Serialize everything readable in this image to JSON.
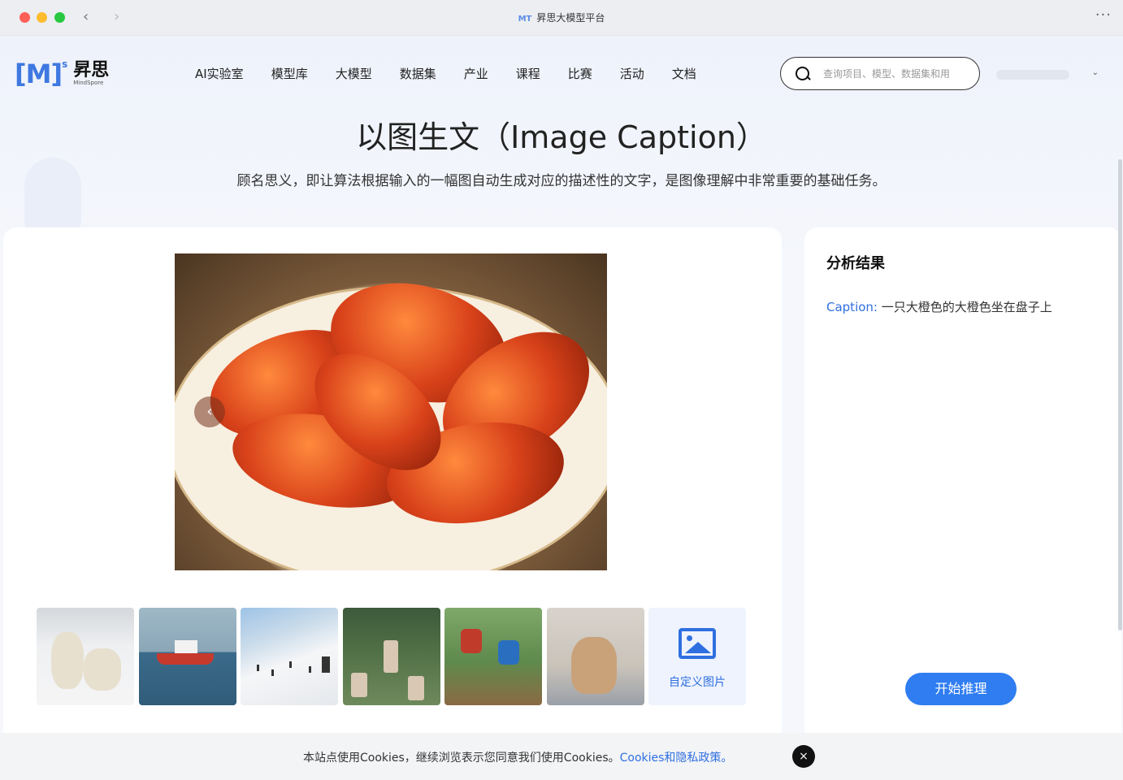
{
  "window": {
    "title": "昇思大模型平台",
    "title_logo": "MT",
    "back_glyph": "‹",
    "forward_glyph": "›",
    "more_glyph": "···"
  },
  "header": {
    "logo_mark": "[M]",
    "logo_sup": "s",
    "logo_cn": "昇思",
    "logo_en": "MindSpore",
    "nav": [
      "AI实验室",
      "模型库",
      "大模型",
      "数据集",
      "产业",
      "课程",
      "比赛",
      "活动",
      "文档"
    ],
    "search_placeholder": "查询项目、模型、数据集和用",
    "user_chevron": "⌄"
  },
  "hero": {
    "title": "以图生文（Image Caption）",
    "description": "顾名思义，即让算法根据输入的一幅图自动生成对应的描述性的文字，是图像理解中非常重要的基础任务。"
  },
  "viewer": {
    "prev_glyph": "‹",
    "thumbnails": [
      "polar-bears",
      "ship",
      "ski-slope",
      "frisbee-game",
      "motocross",
      "dog-on-sofa"
    ],
    "custom_label": "自定义图片"
  },
  "result": {
    "title": "分析结果",
    "caption_key": "Caption:",
    "caption_value": "一只大橙色的大橙色坐在盘子上",
    "start_button": "开始推理"
  },
  "cookie": {
    "text": "本站点使用Cookies，继续浏览表示您同意我们使用Cookies。",
    "link": "Cookies和隐私政策。",
    "close_glyph": "×"
  },
  "colors": {
    "accent": "#2f7df0",
    "link": "#2f6fe0",
    "traffic_red": "#fe5f57",
    "traffic_yellow": "#febc2e",
    "traffic_green": "#28c840"
  }
}
